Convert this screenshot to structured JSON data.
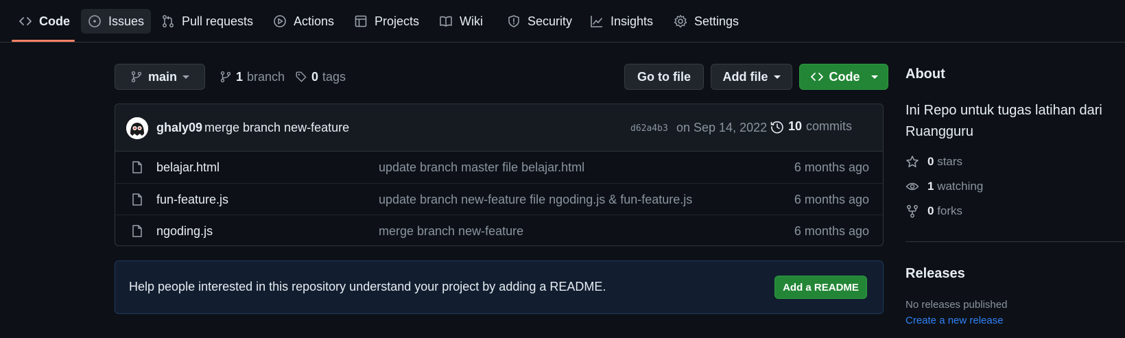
{
  "nav": {
    "code": "Code",
    "issues": "Issues",
    "pulls": "Pull requests",
    "actions": "Actions",
    "projects": "Projects",
    "wiki": "Wiki",
    "security": "Security",
    "insights": "Insights",
    "settings": "Settings"
  },
  "branch": {
    "current": "main",
    "count": "1",
    "branch_label": "branch",
    "tag_count": "0",
    "tag_label": "tags"
  },
  "toolbar": {
    "go_to_file": "Go to file",
    "add_file": "Add file",
    "code": "Code"
  },
  "commit": {
    "author": "ghaly09",
    "message": "merge branch new-feature",
    "sha": "d62a4b3",
    "date": "on Sep 14, 2022",
    "count": "10",
    "count_label": "commits"
  },
  "files": [
    {
      "name": "belajar.html",
      "message": "update branch master file belajar.html",
      "time": "6 months ago"
    },
    {
      "name": "fun-feature.js",
      "message": "update branch new-feature file ngoding.js & fun-feature.js",
      "time": "6 months ago"
    },
    {
      "name": "ngoding.js",
      "message": "merge branch new-feature",
      "time": "6 months ago"
    }
  ],
  "readme": {
    "text": "Help people interested in this repository understand your project by adding a README.",
    "button": "Add a README"
  },
  "about": {
    "title": "About",
    "description": "Ini Repo untuk tugas latihan dari Ruangguru",
    "stars_count": "0",
    "stars_label": "stars",
    "watching_count": "1",
    "watching_label": "watching",
    "forks_count": "0",
    "forks_label": "forks"
  },
  "releases": {
    "title": "Releases",
    "none": "No releases published",
    "create": "Create a new release"
  },
  "colors": {
    "background": "#0d1117",
    "accent_underline": "#f78166",
    "green_button": "#238636",
    "link": "#2f81f7"
  }
}
